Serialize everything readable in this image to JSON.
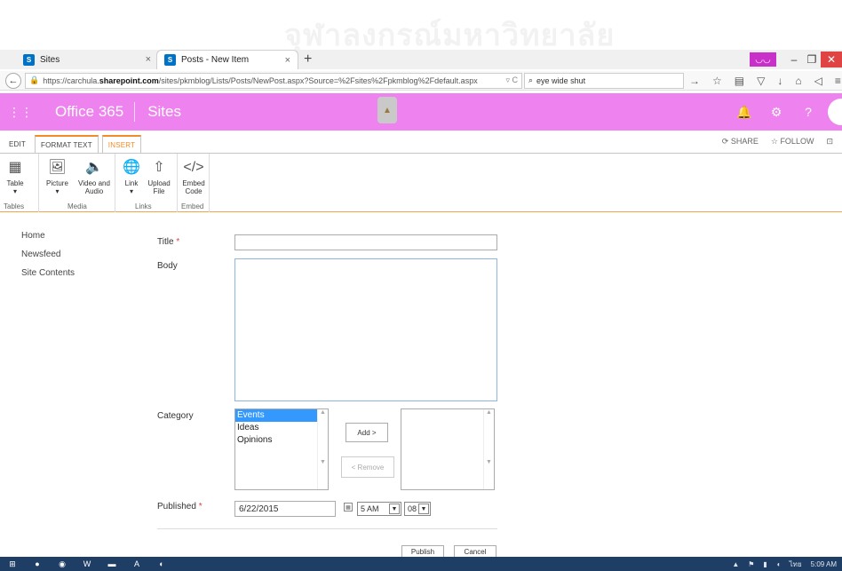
{
  "watermark": "จุฬาลงกรณ์มหาวิทยาลัย",
  "browser": {
    "tabs": [
      {
        "label": "Sites"
      },
      {
        "label": "Posts - New Item"
      }
    ],
    "sp_glyph": "S",
    "url_prefix": "https://carchula.",
    "url_domain": "sharepoint.com",
    "url_rest": "/sites/pkmblog/Lists/Posts/NewPost.aspx?Source=%2Fsites%2Fpkmblog%2Fdefault.aspx",
    "search_value": "eye wide shut"
  },
  "suite": {
    "brand": "Office 365",
    "app": "Sites"
  },
  "ribbon": {
    "tabs": [
      "EDIT",
      "FORMAT TEXT",
      "INSERT"
    ],
    "share_label": "SHARE",
    "follow_label": "FOLLOW",
    "groups": [
      {
        "name": "Tables",
        "buttons": [
          "Table"
        ]
      },
      {
        "name": "Media",
        "buttons": [
          "Picture",
          "Video and Audio"
        ]
      },
      {
        "name": "Links",
        "buttons": [
          "Link",
          "Upload File"
        ]
      },
      {
        "name": "Embed",
        "buttons": [
          "Embed Code"
        ]
      }
    ]
  },
  "leftnav": [
    "Home",
    "Newsfeed",
    "Site Contents"
  ],
  "form": {
    "title_label": "Title",
    "body_label": "Body",
    "category_label": "Category",
    "published_label": "Published",
    "required_mark": "*",
    "categories": [
      "Events",
      "Ideas",
      "Opinions"
    ],
    "selected_category": "Events",
    "add_button": "Add >",
    "remove_button": "< Remove",
    "published_date": "6/22/2015",
    "hour": "5 AM",
    "minute": "08",
    "publish_button": "Publish",
    "cancel_button": "Cancel"
  },
  "taskbar": {
    "tray_lang": "ไทย",
    "time": "5:09 AM"
  }
}
